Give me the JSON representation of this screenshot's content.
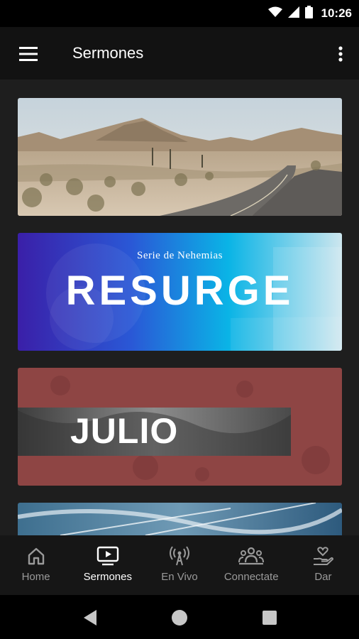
{
  "status_bar": {
    "time": "10:26",
    "icons": [
      "wifi-icon",
      "signal-icon",
      "battery-icon"
    ]
  },
  "app_bar": {
    "title": "Sermones",
    "menu_icon": "hamburger-menu-icon",
    "overflow_icon": "more-vert-icon"
  },
  "sermon_cards": [
    {
      "image": "desert-road-photo"
    },
    {
      "image": "resurge-series-graphic",
      "subtitle": "Serie de Nehemias",
      "title": "RESURGE"
    },
    {
      "image": "julio-series-graphic",
      "title": "JULIO"
    },
    {
      "image": "sky-contrails-photo"
    }
  ],
  "bottom_nav": {
    "items": [
      {
        "label": "Home",
        "icon": "home-icon",
        "active": false
      },
      {
        "label": "Sermones",
        "icon": "video-play-icon",
        "active": true
      },
      {
        "label": "En Vivo",
        "icon": "live-broadcast-icon",
        "active": false
      },
      {
        "label": "Connectate",
        "icon": "people-group-icon",
        "active": false
      },
      {
        "label": "Dar",
        "icon": "give-heart-hand-icon",
        "active": false
      }
    ]
  },
  "system_nav": {
    "back": "back-triangle-icon",
    "home": "home-circle-icon",
    "recents": "recents-square-icon"
  },
  "colors": {
    "background": "#121212",
    "content_bg": "#1e1e1e",
    "nav_inactive": "#9a9a9a",
    "nav_active": "#ffffff",
    "julio_card": "#8e4544",
    "resurge_gradient_start": "#3a1fa8",
    "resurge_gradient_end": "#00c4ea"
  }
}
